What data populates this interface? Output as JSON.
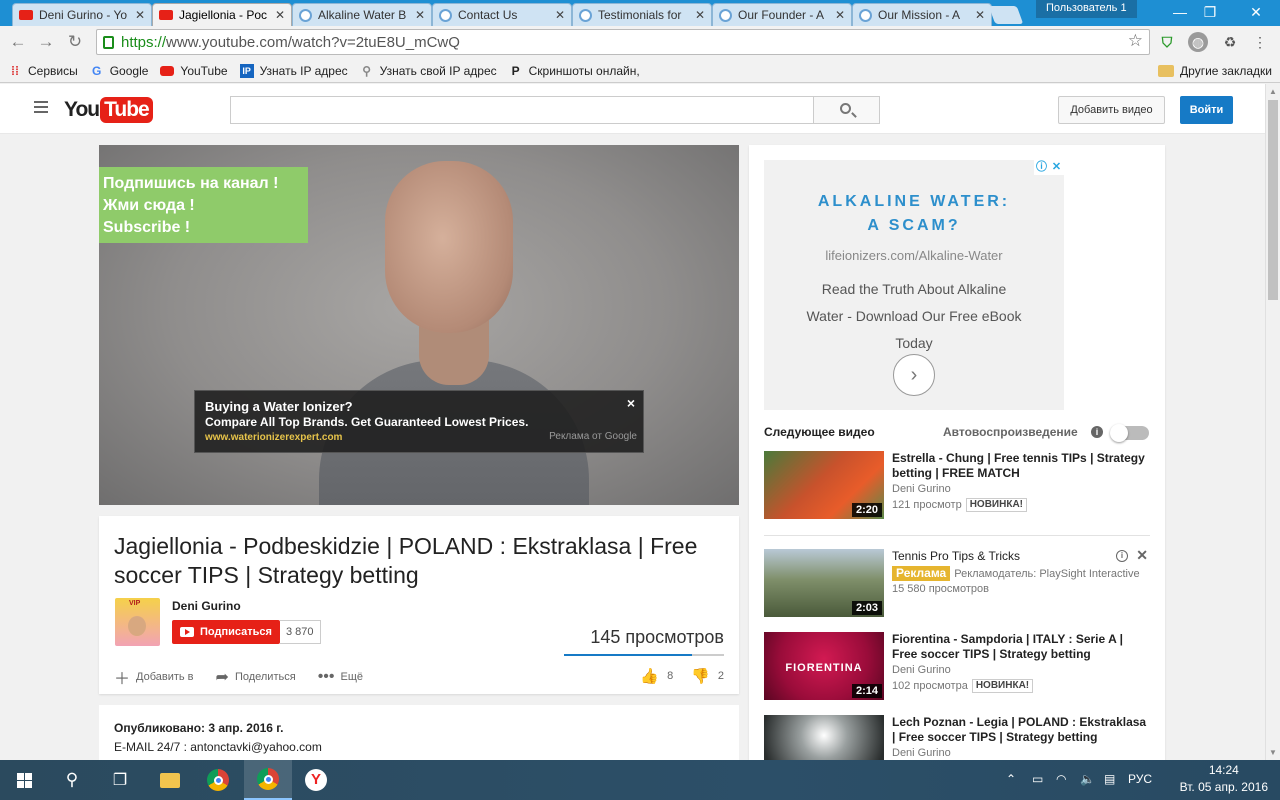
{
  "browser": {
    "tabs": [
      {
        "label": "Deni Gurino - Yo",
        "icon": "youtube-icon"
      },
      {
        "label": "Jagiellonia - Poc",
        "icon": "youtube-icon",
        "active": true
      },
      {
        "label": "Alkaline Water B",
        "icon": "generic-page-icon"
      },
      {
        "label": "Contact Us",
        "icon": "generic-page-icon"
      },
      {
        "label": "Testimonials for",
        "icon": "generic-page-icon"
      },
      {
        "label": "Our Founder - A",
        "icon": "generic-page-icon"
      },
      {
        "label": "Our Mission - A",
        "icon": "generic-page-icon"
      }
    ],
    "profile_label": "Пользователь 1",
    "url_scheme": "https://",
    "url_rest": "www.youtube.com/watch?v=2tuE8U_mCwQ",
    "bookmarks": [
      {
        "label": "Сервисы",
        "icon": "apps-grid-icon"
      },
      {
        "label": "Google",
        "icon": "google-icon"
      },
      {
        "label": "YouTube",
        "icon": "youtube-icon"
      },
      {
        "label": "Узнать IP адрес",
        "icon": "ip-icon"
      },
      {
        "label": "Узнать свой IP адрес",
        "icon": "search-icon"
      },
      {
        "label": "Скриншоты онлайн,",
        "icon": "p-icon"
      }
    ],
    "other_bookmarks": "Другие закладки"
  },
  "youtube": {
    "logo_you": "You",
    "logo_tube": "Tube",
    "upload_label": "Добавить видео",
    "signin_label": "Войти",
    "search_value": ""
  },
  "player": {
    "subscribe_overlay": [
      "Подпишись на канал !",
      "Жми сюда !",
      "Subscribe !"
    ],
    "overlay_ad": {
      "headline": "Buying a Water Ionizer?",
      "body": "Compare All Top Brands. Get Guaranteed Lowest Prices.",
      "url": "www.waterionizerexpert.com",
      "attribution": "Реклама от Google",
      "close": "×"
    }
  },
  "video": {
    "title": "Jagiellonia - Podbeskidzie | POLAND : Ekstraklasa | Free soccer TIPS | Strategy betting",
    "channel": "Deni Gurino",
    "avatar_text": "VIP",
    "subscribe_label": "Подписаться",
    "subscriber_count": "3 870",
    "views": "145 просмотров",
    "like_ratio": 0.8,
    "actions": [
      {
        "label": "Добавить в",
        "icon": "plus-icon"
      },
      {
        "label": "Поделиться",
        "icon": "share-icon"
      },
      {
        "label": "Ещё",
        "icon": "more-icon"
      }
    ],
    "likes": "8",
    "dislikes": "2",
    "published": "Опубликовано: 3 апр. 2016 г.",
    "description_line": "E-MAIL 24/7 : antonctavki@yahoo.com"
  },
  "sidebar": {
    "ad": {
      "headline_line1": "ALKALINE WATER:",
      "headline_line2": "A SCAM?",
      "url": "lifeionizers.com/Alkaline-Water",
      "body": "Read the Truth About Alkaline Water - Download Our Free eBook Today",
      "accent_color": "#2d8fcc"
    },
    "up_next_label": "Следующее видео",
    "autoplay_label": "Автовоспроизведение",
    "autoplay_on": false,
    "related": [
      {
        "title": "Estrella - Chung | Free tennis TIPs | Strategy betting | FREE MATCH",
        "channel": "Deni Gurino",
        "views": "121 просмотр",
        "badge": "НОВИНКА!",
        "duration": "2:20"
      },
      {
        "title": "Tennis Pro Tips & Tricks",
        "ad_badge": "Реклама",
        "advertiser": "Рекламодатель: PlaySight Interactive",
        "views": "15 580 просмотров",
        "duration": "2:03"
      },
      {
        "title": "Fiorentina - Sampdoria | ITALY : Serie A | Free soccer TIPS | Strategy betting",
        "channel": "Deni Gurino",
        "views": "102 просмотра",
        "badge": "НОВИНКА!",
        "duration": "2:14",
        "thumb_text": "FIORENTINA"
      },
      {
        "title": "Lech Poznan - Legia | POLAND : Ekstraklasa | Free soccer TIPS | Strategy betting",
        "channel": "Deni Gurino"
      }
    ]
  },
  "taskbar": {
    "language": "РУС",
    "time": "14:24",
    "date": "Вт. 05 апр. 2016"
  }
}
